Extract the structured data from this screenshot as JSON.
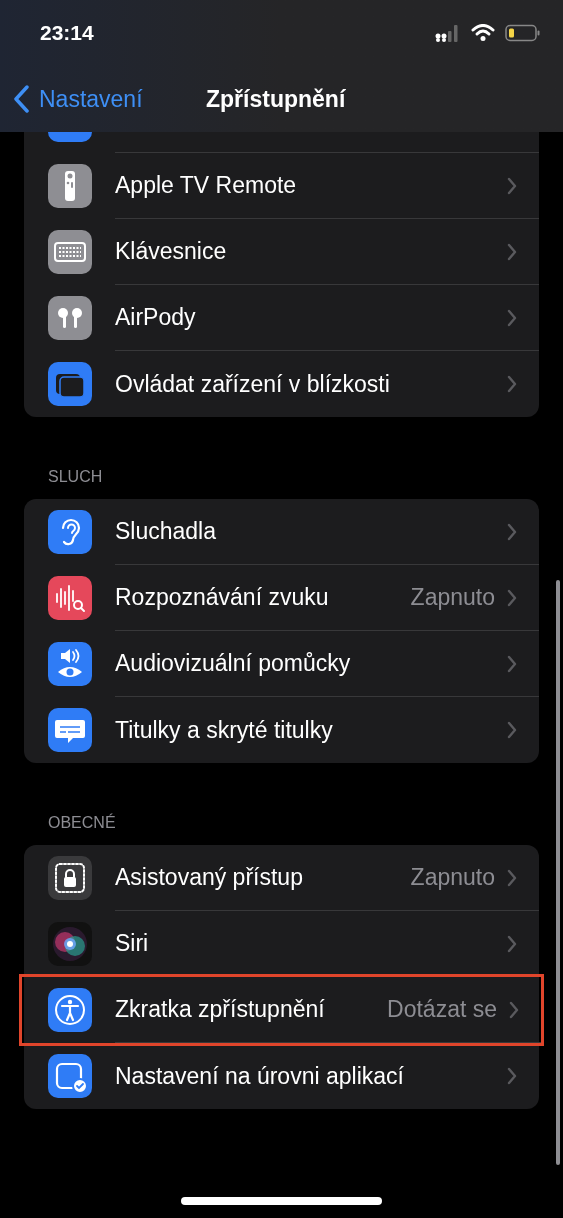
{
  "status_bar": {
    "time": "23:14"
  },
  "nav": {
    "back": "Nastavení",
    "title": "Zpřístupnění"
  },
  "sections": [
    {
      "rows": [
        {
          "label": "Apple TV Remote",
          "highlighted": false
        },
        {
          "label": "Klávesnice",
          "highlighted": false
        },
        {
          "label": "AirPody",
          "highlighted": false
        },
        {
          "label": "Ovládat zařízení v blízkosti",
          "highlighted": false
        }
      ]
    },
    {
      "header": "SLUCH",
      "rows": [
        {
          "label": "Sluchadla",
          "highlighted": false
        },
        {
          "label": "Rozpoznávání zvuku",
          "value": "Zapnuto",
          "highlighted": false
        },
        {
          "label": "Audiovizuální pomůcky",
          "highlighted": false
        },
        {
          "label": "Titulky a skryté titulky",
          "highlighted": false
        }
      ]
    },
    {
      "header": "OBECNÉ",
      "rows": [
        {
          "label": "Asistovaný přístup",
          "value": "Zapnuto",
          "highlighted": false
        },
        {
          "label": "Siri",
          "highlighted": false
        },
        {
          "label": "Zkratka zpřístupnění",
          "value": "Dotázat se",
          "highlighted": true
        },
        {
          "label": "Nastavení na úrovni aplikací",
          "highlighted": false
        }
      ]
    }
  ]
}
